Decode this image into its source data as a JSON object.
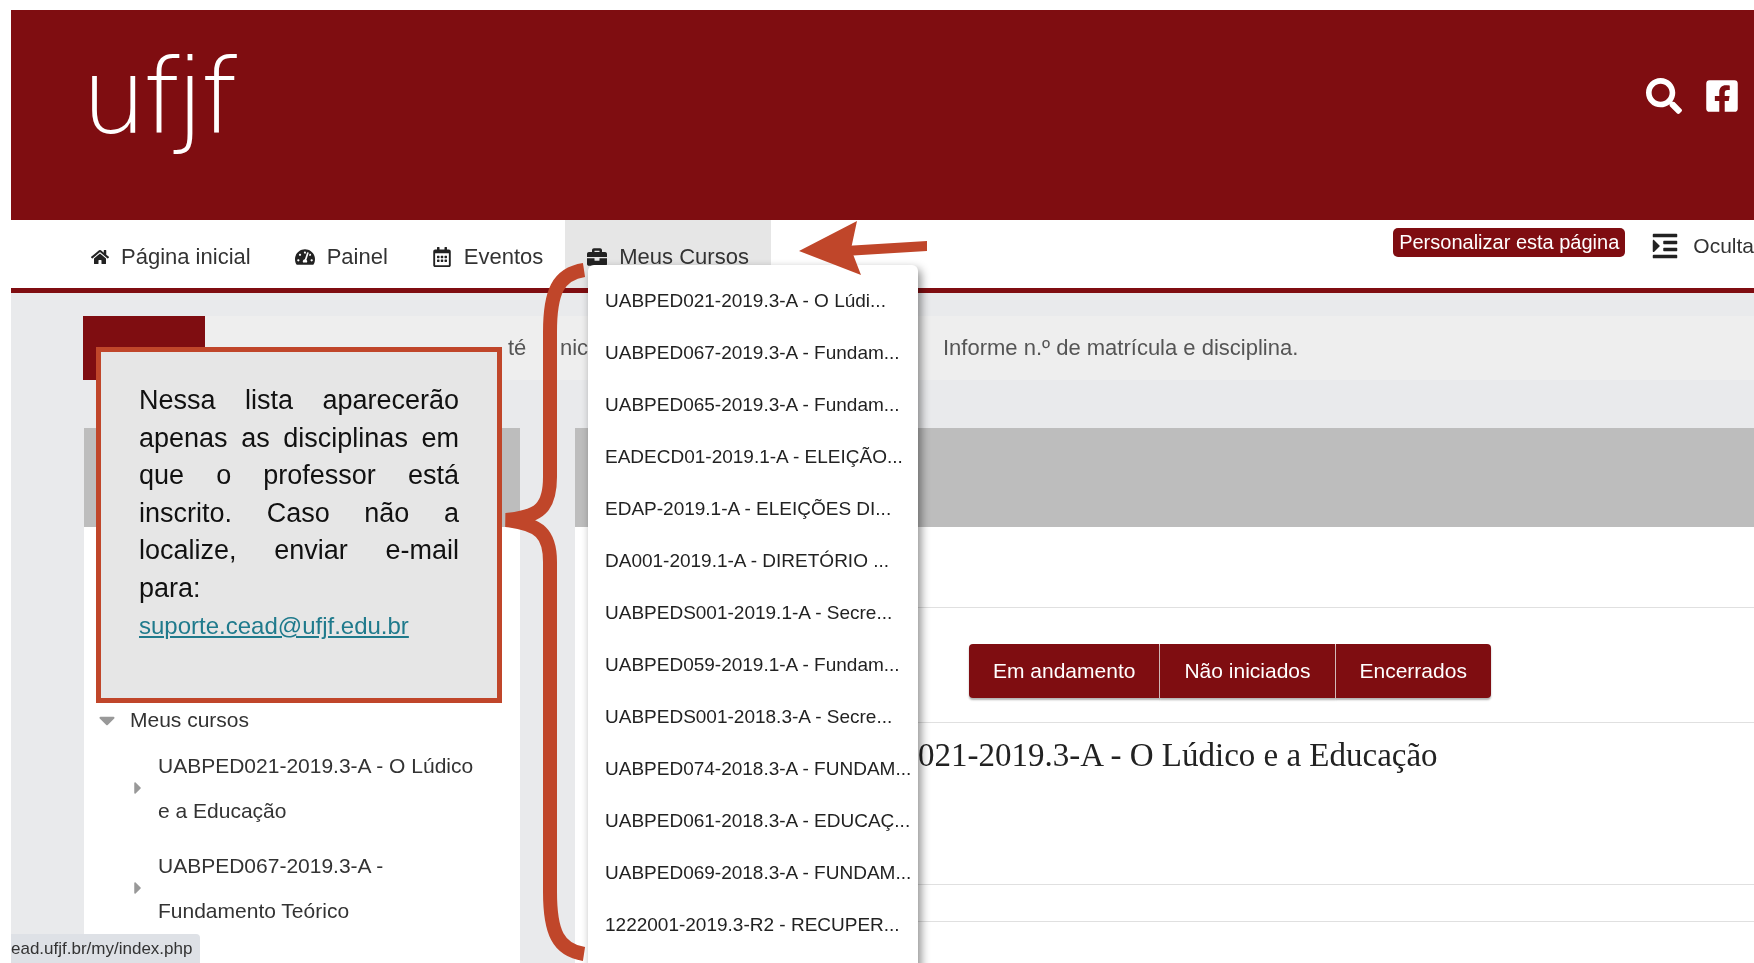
{
  "header": {
    "logo": "ufjf"
  },
  "nav": {
    "items": [
      {
        "kind": "home",
        "label": "Página inicial",
        "selected": false
      },
      {
        "kind": "dashboard",
        "label": "Painel",
        "selected": false
      },
      {
        "kind": "calendar",
        "label": "Eventos",
        "selected": false
      },
      {
        "kind": "courses",
        "label": "Meus Cursos",
        "selected": true
      }
    ],
    "customize_button": "Personalizar esta página",
    "hide_label": "Oculta"
  },
  "notice": {
    "fragments": [
      "té",
      "nic"
    ],
    "text_after": "Informe n.º de matrícula e disciplina."
  },
  "sidebar": {
    "tree": {
      "label": "Meus cursos",
      "expanded": true,
      "children": [
        {
          "lines": [
            "UABPED021-2019.3-A - O Lúdico",
            "e a Educação"
          ],
          "expanded": false
        },
        {
          "lines": [
            "UABPED067-2019.3-A -",
            "Fundamento Teórico"
          ],
          "expanded": false
        }
      ]
    }
  },
  "course_filters": [
    {
      "label": "Em andamento"
    },
    {
      "label": "Não iniciados"
    },
    {
      "label": "Encerrados"
    }
  ],
  "course_title": "021-2019.3-A - O Lúdico e a Educação",
  "dropdown": {
    "items": [
      "UABPED021-2019.3-A - O Lúdi...",
      "UABPED067-2019.3-A - Fundam...",
      "UABPED065-2019.3-A - Fundam...",
      "EADECD01-2019.1-A - ELEIÇÃO...",
      "EDAP-2019.1-A - ELEIÇÕES DI...",
      "DA001-2019.1-A - DIRETÓRIO ...",
      "UABPEDS001-2019.1-A - Secre...",
      "UABPED059-2019.1-A - Fundam...",
      "UABPEDS001-2018.3-A - Secre...",
      "UABPED074-2018.3-A - FUNDAM...",
      "UABPED061-2018.3-A - EDUCAÇ...",
      "UABPED069-2018.3-A - FUNDAM...",
      "1222001-2019.3-R2 - RECUPER..."
    ]
  },
  "callout": {
    "text": "Nessa lista aparecerão apenas as disciplinas em que o professor está inscrito. Caso não a localize, enviar e-mail para:",
    "email": "suporte.cead@ufjf.edu.br"
  },
  "status_bar": {
    "url": "ead.ufjf.br/my/index.php"
  }
}
